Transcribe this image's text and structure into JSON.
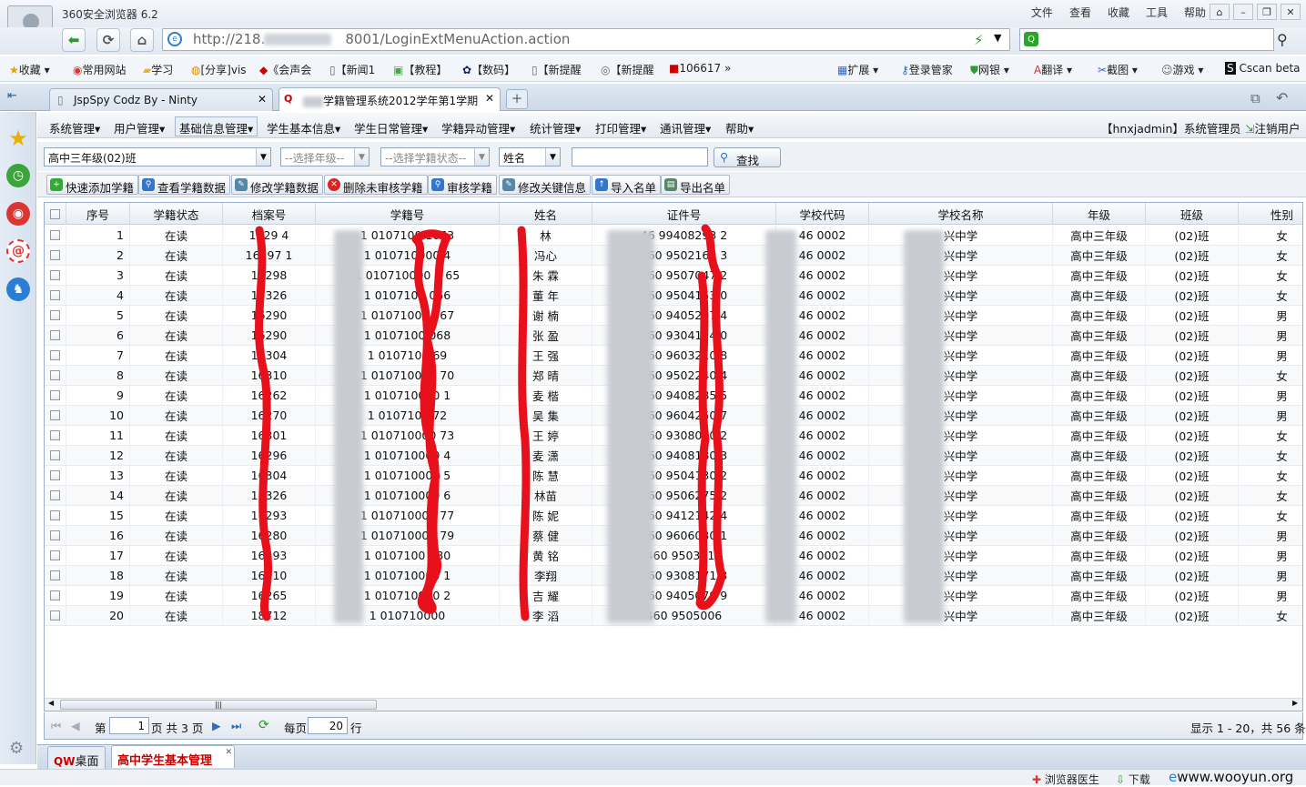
{
  "browser": {
    "title": "360安全浏览器 6.2",
    "menu": [
      "文件",
      "查看",
      "收藏",
      "工具",
      "帮助"
    ],
    "url_prefix": "http://218.",
    "url_suffix": "8001/LoginExtMenuAction.action",
    "search_placeholder": ""
  },
  "favorites": [
    "收藏",
    "常用网站",
    "学习",
    "[分享]vis",
    "《会声会",
    "【新闻1",
    "【教程】",
    "【数码】",
    "【新提醒",
    "【新提醒",
    "106617"
  ],
  "favorites_right": [
    "扩展",
    "登录管家",
    "网银",
    "翻译",
    "截图",
    "游戏",
    "Cscan beta"
  ],
  "browser_tabs": [
    {
      "label": "JspSpy Codz By - Ninty"
    },
    {
      "label": "学籍管理系统2012学年第1学期"
    }
  ],
  "app_menu": [
    "系统管理",
    "用户管理",
    "基础信息管理",
    "学生基本信息",
    "学生日常管理",
    "学籍异动管理",
    "统计管理",
    "打印管理",
    "通讯管理",
    "帮助"
  ],
  "user_info": "【hnxjadmin】系统管理员",
  "logout": "注销用户",
  "filters": {
    "class_value": "高中三年级(02)班",
    "grade_placeholder": "--选择年级--",
    "status_placeholder": "--选择学籍状态--",
    "field_value": "姓名",
    "keyword": "",
    "find": "查找"
  },
  "actions": [
    "快速添加学籍",
    "查看学籍数据",
    "修改学籍数据",
    "删除未审核学籍",
    "审核学籍",
    "修改关键信息",
    "导入名单",
    "导出名单"
  ],
  "columns": [
    "序号",
    "学籍状态",
    "档案号",
    "学籍号",
    "姓名",
    "证件号",
    "学校代码",
    "学校名称",
    "年级",
    "班级",
    "性别"
  ],
  "rows": [
    {
      "no": "1",
      "status": "在读",
      "file": "1629 4",
      "sid": "1 0107100 1063",
      "name": "林",
      "id": "46  99408293 2",
      "code": "46 0002",
      "school": "兴中学",
      "grade": "高中三年级",
      "class": "(02)班",
      "sex": "女"
    },
    {
      "no": "2",
      "status": "在读",
      "file": "16297 1",
      "sid": "1 010710000 4",
      "name": "冯心",
      "id": "460 9502160 3",
      "code": "46 0002",
      "school": "兴中学",
      "grade": "高中三年级",
      "class": "(02)班",
      "sex": "女"
    },
    {
      "no": "3",
      "status": "在读",
      "file": "16298",
      "sid": "1 010710000 1 65",
      "name": "朱 霖",
      "id": "460 9507047 2",
      "code": "46 0002",
      "school": "兴中学",
      "grade": "高中三年级",
      "class": "(02)班",
      "sex": "女"
    },
    {
      "no": "4",
      "status": "在读",
      "file": "16326",
      "sid": "1 0107100 066",
      "name": "董 年",
      "id": "460 9504153 0",
      "code": "46 0002",
      "school": "兴中学",
      "grade": "高中三年级",
      "class": "(02)班",
      "sex": "女"
    },
    {
      "no": "5",
      "status": "在读",
      "file": "16290",
      "sid": "1 01071000 067",
      "name": "谢 楠",
      "id": "460 9405207 4",
      "code": "46 0002",
      "school": "兴中学",
      "grade": "高中三年级",
      "class": "(02)班",
      "sex": "男"
    },
    {
      "no": "6",
      "status": "在读",
      "file": "16290",
      "sid": "1 0107100 068",
      "name": "张 盈",
      "id": "460 9304114 0",
      "code": "46 0002",
      "school": "兴中学",
      "grade": "高中三年级",
      "class": "(02)班",
      "sex": "男"
    },
    {
      "no": "7",
      "status": "在读",
      "file": "16304",
      "sid": "1 0107100 69",
      "name": "王 强",
      "id": "460 9603210 8",
      "code": "46 0002",
      "school": "兴中学",
      "grade": "高中三年级",
      "class": "(02)班",
      "sex": "男"
    },
    {
      "no": "8",
      "status": "在读",
      "file": "16310",
      "sid": "1 010710000 70",
      "name": "郑 晴",
      "id": "460 9502240 4",
      "code": "46 0002",
      "school": "兴中学",
      "grade": "高中三年级",
      "class": "(02)班",
      "sex": "女"
    },
    {
      "no": "9",
      "status": "在读",
      "file": "16262",
      "sid": "1 010710000 1",
      "name": "麦 楷",
      "id": "460 9408285 5",
      "code": "46 0002",
      "school": "兴中学",
      "grade": "高中三年级",
      "class": "(02)班",
      "sex": "男"
    },
    {
      "no": "10",
      "status": "在读",
      "file": "16270",
      "sid": "1 0107100 72",
      "name": "吴 集",
      "id": "460 9604250 7",
      "code": "46 0002",
      "school": "兴中学",
      "grade": "高中三年级",
      "class": "(02)班",
      "sex": "男"
    },
    {
      "no": "11",
      "status": "在读",
      "file": "16301",
      "sid": "1 010710000 73",
      "name": "王 婷",
      "id": "460 9308070 2",
      "code": "46 0002",
      "school": "兴中学",
      "grade": "高中三年级",
      "class": "(02)班",
      "sex": "女"
    },
    {
      "no": "12",
      "status": "在读",
      "file": "16296",
      "sid": "1 010710000 4",
      "name": "麦 潇",
      "id": "460 9408180 3",
      "code": "46 0002",
      "school": "兴中学",
      "grade": "高中三年级",
      "class": "(02)班",
      "sex": "女"
    },
    {
      "no": "13",
      "status": "在读",
      "file": "16304",
      "sid": "1 010710000 5",
      "name": "陈 慧",
      "id": "460 9504130 2",
      "code": "46 0002",
      "school": "兴中学",
      "grade": "高中三年级",
      "class": "(02)班",
      "sex": "女"
    },
    {
      "no": "14",
      "status": "在读",
      "file": "16326",
      "sid": "1 010710000 6",
      "name": "林苗",
      "id": "460 9506275 2",
      "code": "46 0002",
      "school": "兴中学",
      "grade": "高中三年级",
      "class": "(02)班",
      "sex": "女"
    },
    {
      "no": "15",
      "status": "在读",
      "file": "16293",
      "sid": "1 010710000 77",
      "name": "陈 妮",
      "id": "460 9412142 4",
      "code": "46 0002",
      "school": "兴中学",
      "grade": "高中三年级",
      "class": "(02)班",
      "sex": "女"
    },
    {
      "no": "16",
      "status": "在读",
      "file": "16280",
      "sid": "1 010710000 79",
      "name": "蔡 健",
      "id": "460 9606030 1",
      "code": "46 0002",
      "school": "兴中学",
      "grade": "高中三年级",
      "class": "(02)班",
      "sex": "男"
    },
    {
      "no": "17",
      "status": "在读",
      "file": "16293",
      "sid": "1 0107100 080",
      "name": "黄 铭",
      "id": "460 9503117",
      "code": "46 0002",
      "school": "兴中学",
      "grade": "高中三年级",
      "class": "(02)班",
      "sex": "男"
    },
    {
      "no": "18",
      "status": "在读",
      "file": "16310",
      "sid": "1 010710000 1",
      "name": "李翔",
      "id": "460 9308171 8",
      "code": "46 0002",
      "school": "兴中学",
      "grade": "高中三年级",
      "class": "(02)班",
      "sex": "男"
    },
    {
      "no": "19",
      "status": "在读",
      "file": "16265",
      "sid": "1 010710000 2",
      "name": "吉 耀",
      "id": "460 9405079 9",
      "code": "46 0002",
      "school": "兴中学",
      "grade": "高中三年级",
      "class": "(02)班",
      "sex": "男"
    },
    {
      "no": "20",
      "status": "在读",
      "file": "18712",
      "sid": "1 010710000",
      "name": "李 滔",
      "id": "460 9505006",
      "code": "46 0002",
      "school": "兴中学",
      "grade": "高中三年级",
      "class": "(02)班",
      "sex": "女"
    }
  ],
  "pager": {
    "page_label": "第",
    "page": "1",
    "total_label": "页 共 3 页",
    "per_page_label": "每页",
    "per_page": "20",
    "rows_label": "行",
    "summary": "显示 1 - 20，共 56 条"
  },
  "bottom_tabs": [
    "桌面",
    "高中学生基本管理"
  ],
  "status": [
    "浏览器医生",
    "下载",
    "www.wooyun.org"
  ],
  "colors": {
    "accent": "#2a7fd4",
    "redmark": "#e8101a",
    "tab_active": "#c80000"
  }
}
